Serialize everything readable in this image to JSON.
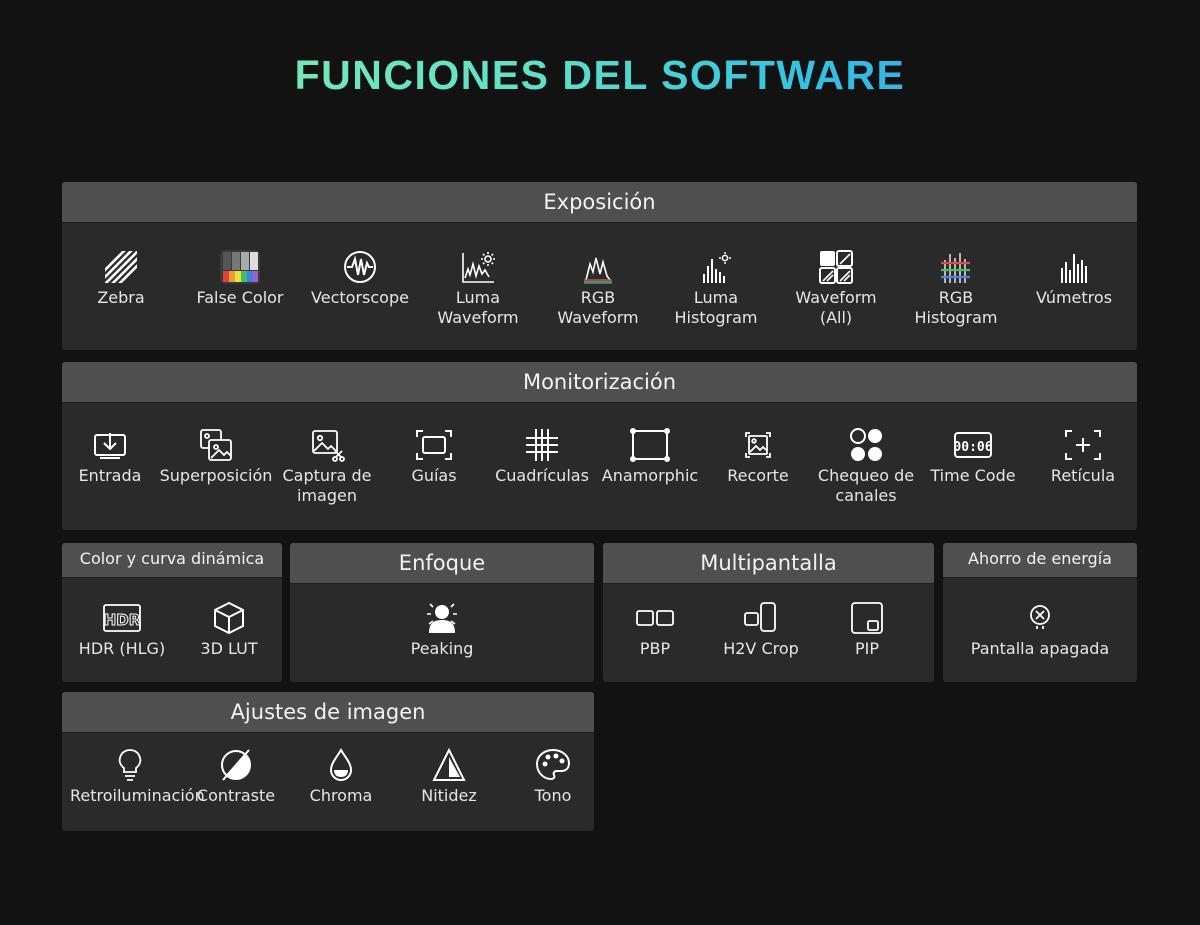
{
  "title": "FUNCIONES DEL SOFTWARE",
  "colors": {
    "title_gradient": [
      "#8cf2a8",
      "#35c6e0",
      "#2f8fee"
    ],
    "panel_bg": "#2a2a2a",
    "header_bg": "#4f4f4f"
  },
  "exposicion": {
    "header": "Exposición",
    "items": [
      {
        "l1": "Zebra",
        "l2": "",
        "icon": "zebra-icon"
      },
      {
        "l1": "False Color",
        "l2": "",
        "icon": "false-color-icon"
      },
      {
        "l1": "Vectorscope",
        "l2": "",
        "icon": "vectorscope-icon"
      },
      {
        "l1": "Luma",
        "l2": "Waveform",
        "icon": "luma-waveform-icon"
      },
      {
        "l1": "RGB",
        "l2": "Waveform",
        "icon": "rgb-waveform-icon"
      },
      {
        "l1": "Luma",
        "l2": "Histogram",
        "icon": "luma-histogram-icon"
      },
      {
        "l1": "Waveform",
        "l2": "(All)",
        "icon": "waveform-all-icon"
      },
      {
        "l1": "RGB",
        "l2": "Histogram",
        "icon": "rgb-histogram-icon"
      },
      {
        "l1": "Vúmetros",
        "l2": "",
        "icon": "vu-meter-icon"
      }
    ]
  },
  "monitorizacion": {
    "header": "Monitorización",
    "items": [
      {
        "l1": "Entrada",
        "l2": "",
        "icon": "input-icon"
      },
      {
        "l1": "Superposición",
        "l2": "",
        "icon": "overlay-icon"
      },
      {
        "l1": "Captura de",
        "l2": "imagen",
        "icon": "capture-icon"
      },
      {
        "l1": "Guías",
        "l2": "",
        "icon": "guides-icon"
      },
      {
        "l1": "Cuadrículas",
        "l2": "",
        "icon": "grid-icon"
      },
      {
        "l1": "Anamorphic",
        "l2": "",
        "icon": "anamorphic-icon"
      },
      {
        "l1": "Recorte",
        "l2": "",
        "icon": "crop-icon"
      },
      {
        "l1": "Chequeo de",
        "l2": "canales",
        "icon": "channel-check-icon"
      },
      {
        "l1": "Time Code",
        "l2": "",
        "icon": "timecode-icon"
      },
      {
        "l1": "Retícula",
        "l2": "",
        "icon": "reticle-icon"
      }
    ]
  },
  "color": {
    "header": "Color y curva dinámica",
    "items": [
      {
        "l1": "HDR (HLG)",
        "icon": "hdr-icon"
      },
      {
        "l1": "3D LUT",
        "icon": "lut-cube-icon"
      }
    ]
  },
  "enfoque": {
    "header": "Enfoque",
    "items": [
      {
        "l1": "Peaking",
        "icon": "peaking-icon"
      }
    ]
  },
  "multipantalla": {
    "header": "Multipantalla",
    "items": [
      {
        "l1": "PBP",
        "icon": "pbp-icon"
      },
      {
        "l1": "H2V Crop",
        "icon": "h2v-crop-icon"
      },
      {
        "l1": "PIP",
        "icon": "pip-icon"
      }
    ]
  },
  "ahorro": {
    "header": "Ahorro de energía",
    "items": [
      {
        "l1": "Pantalla apagada",
        "icon": "screen-off-icon"
      }
    ]
  },
  "ajustes": {
    "header": "Ajustes de imagen",
    "items": [
      {
        "l1": "Retroiluminación",
        "icon": "backlight-icon"
      },
      {
        "l1": "Contraste",
        "icon": "contrast-icon"
      },
      {
        "l1": "Chroma",
        "icon": "chroma-icon"
      },
      {
        "l1": "Nitidez",
        "icon": "sharpness-icon"
      },
      {
        "l1": "Tono",
        "icon": "hue-palette-icon"
      }
    ]
  }
}
